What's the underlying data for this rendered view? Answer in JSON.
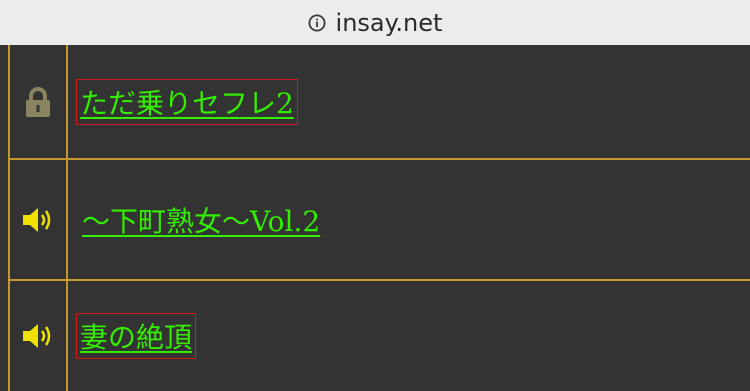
{
  "browser": {
    "url": "insay.net",
    "info_icon": "info-circle-icon"
  },
  "rows": [
    {
      "icon": "lock-icon",
      "title": "ただ乗りセフレ2",
      "highlighted": true
    },
    {
      "icon": "speaker-icon",
      "title": "～下町熟女～Vol.2",
      "highlighted": false
    },
    {
      "icon": "speaker-icon",
      "title": "妻の絶頂",
      "highlighted": true
    }
  ],
  "colors": {
    "background": "#333333",
    "border": "#c8962f",
    "link": "#33ee00",
    "highlight_box": "#d11a1a",
    "lock_icon": "#8a8560",
    "speaker_icon": "#f0e000"
  }
}
